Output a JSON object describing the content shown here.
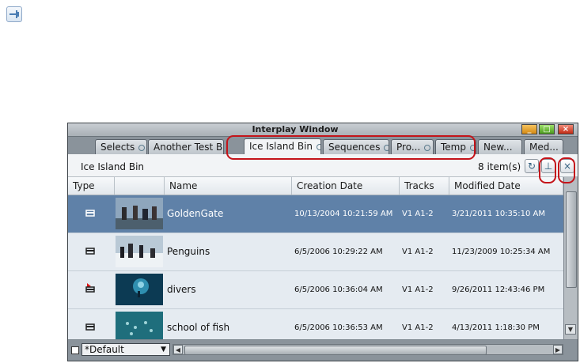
{
  "window": {
    "title": "Interplay Window"
  },
  "tabs": [
    {
      "label": "Selects"
    },
    {
      "label": "Another Test Bin"
    },
    {
      "label": "Ice Island Bin"
    },
    {
      "label": "Sequences"
    },
    {
      "label": "Pro..."
    },
    {
      "label": "Temp"
    },
    {
      "label": "New..."
    },
    {
      "label": "Med..."
    }
  ],
  "bin": {
    "name": "Ice Island Bin",
    "item_count": "8 item(s)"
  },
  "columns": {
    "type": "Type",
    "thumb": "",
    "name": "Name",
    "creation": "Creation Date",
    "tracks": "Tracks",
    "modified": "Modified Date"
  },
  "rows": [
    {
      "name": "GoldenGate",
      "creation": "10/13/2004 10:21:59 AM",
      "tracks": "V1 A1-2",
      "modified": "3/21/2011 10:35:10 AM",
      "icon": "clip-icon"
    },
    {
      "name": "Penguins",
      "creation": "6/5/2006 10:29:22 AM",
      "tracks": "V1 A1-2",
      "modified": "11/23/2009 10:25:34 AM",
      "icon": "clip-icon"
    },
    {
      "name": "divers",
      "creation": "6/5/2006 10:36:04 AM",
      "tracks": "V1 A1-2",
      "modified": "9/26/2011 12:43:46 PM",
      "icon": "clip-alert-icon"
    },
    {
      "name": "school of fish",
      "creation": "6/5/2006 10:36:53 AM",
      "tracks": "V1 A1-2",
      "modified": "4/13/2011 1:18:30 PM",
      "icon": "clip-icon"
    }
  ],
  "footer": {
    "view": "*Default"
  },
  "colors": {
    "selected_row": "#5f81a8",
    "highlight": "#c4141a"
  }
}
